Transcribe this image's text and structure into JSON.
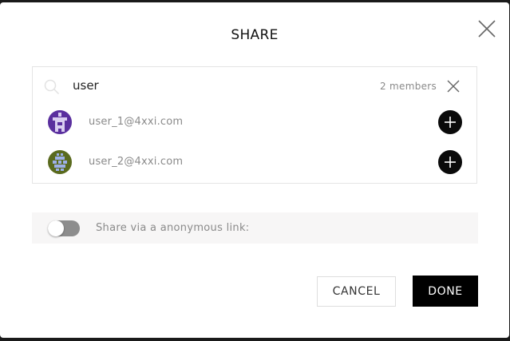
{
  "dialog": {
    "title": "SHARE",
    "close_icon": "close-icon"
  },
  "search": {
    "value": "user",
    "icon": "search-icon",
    "member_count": "2 members",
    "clear_icon": "close-icon"
  },
  "users": [
    {
      "email": "user_1@4xxi.com",
      "avatar_color": "#5a2f9e",
      "add_icon": "plus-icon"
    },
    {
      "email": "user_2@4xxi.com",
      "avatar_color": "#5a6a1e",
      "add_icon": "plus-icon"
    }
  ],
  "share_link": {
    "label": "Share via a anonymous link:",
    "enabled": false
  },
  "actions": {
    "cancel_label": "CANCEL",
    "done_label": "DONE"
  },
  "colors": {
    "primary_button": "#000000",
    "muted_text": "#8a8a8a",
    "border": "#e4e4e4"
  }
}
